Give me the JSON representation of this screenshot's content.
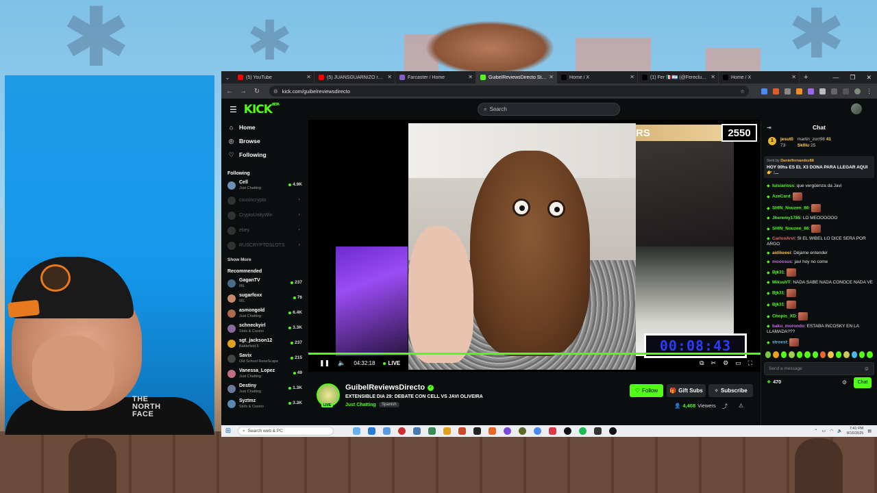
{
  "browser": {
    "tabs": [
      {
        "title": "(5) YouTube",
        "color": "#ff0000",
        "active": false
      },
      {
        "title": "(5) JUANSGUARNIZO reaccion...",
        "color": "#ff0000",
        "active": false
      },
      {
        "title": "Farcaster / Home",
        "color": "#855dcd",
        "active": false
      },
      {
        "title": "GuibelReviewsDirecto Strea...",
        "color": "#53fc18",
        "active": true
      },
      {
        "title": "Home / X",
        "color": "#000000",
        "active": false
      },
      {
        "title": "(1) Fer 🇲🇽🇦🇷 (@Fereclum) / X",
        "color": "#000000",
        "active": false
      },
      {
        "title": "Home / X",
        "color": "#000000",
        "active": false
      }
    ],
    "url": "kick.com/guibelreviewsdirecto"
  },
  "kick": {
    "logo": "KICK",
    "beta": "BETA",
    "search_placeholder": "Search",
    "nav": [
      {
        "label": "Home",
        "icon": "home-icon"
      },
      {
        "label": "Browse",
        "icon": "compass-icon"
      },
      {
        "label": "Following",
        "icon": "heart-icon"
      }
    ],
    "following_header": "Following",
    "following": [
      {
        "name": "Cell",
        "category": "Just Chatting",
        "viewers": "4.9K",
        "live": true,
        "color": "#6e8fb5"
      },
      {
        "name": "cousincrypto",
        "category": "",
        "viewers": "",
        "live": false,
        "color": "#777"
      },
      {
        "name": "CryptoUnityWin",
        "category": "",
        "viewers": "",
        "live": false,
        "color": "#777"
      },
      {
        "name": "ebey",
        "category": "",
        "viewers": "",
        "live": false,
        "color": "#777"
      },
      {
        "name": "RUSCRYPTOSLOTS",
        "category": "",
        "viewers": "",
        "live": false,
        "color": "#777"
      }
    ],
    "show_more": "Show More",
    "recommended_header": "Recommended",
    "recommended": [
      {
        "name": "GaganTV",
        "category": "IRL",
        "viewers": "237",
        "color": "#4a6b8a"
      },
      {
        "name": "sugarfoxx",
        "category": "IRL",
        "viewers": "76",
        "color": "#c48a6a"
      },
      {
        "name": "asmongold",
        "category": "Just Chatting",
        "viewers": "6.4K",
        "color": "#b06a4a"
      },
      {
        "name": "schneckyirl",
        "category": "Slots & Casino",
        "viewers": "3.3K",
        "color": "#8a6a9a"
      },
      {
        "name": "sgt_jackson12",
        "category": "Battlefield 6",
        "viewers": "237",
        "color": "#e0a020"
      },
      {
        "name": "Savix",
        "category": "Old School RuneScape",
        "viewers": "215",
        "color": "#444"
      },
      {
        "name": "Vanessa_Lopez",
        "category": "Just Chatting",
        "viewers": "49",
        "color": "#c07080"
      },
      {
        "name": "Destiny",
        "category": "Just Chatting",
        "viewers": "1.3K",
        "color": "#6a7a9a"
      },
      {
        "name": "Syztmz",
        "category": "Slots & Casino",
        "viewers": "3.3K",
        "color": "#5a8ab0"
      }
    ],
    "player": {
      "score_letters": "RS",
      "score": "2550",
      "timer": "00:08:43",
      "elapsed": "04:32:18",
      "live_label": "LIVE"
    },
    "stream": {
      "streamer": "GuibelReviewsDirecto",
      "live_tag": "LIVE",
      "title": "EXTENSIBLE DIA 29: DEBATE CON CELL VS JAVI OLIVEIRA",
      "category": "Just Chatting",
      "language": "Spanish",
      "follow_label": "Follow",
      "gift_label": "Gift Subs",
      "subscribe_label": "Subscribe",
      "viewers_count": "4,408",
      "viewers_label": "Viewers"
    },
    "chat": {
      "title": "Chat",
      "gifters": {
        "rank": "1",
        "g1_name": "jesut0",
        "g1_count": "73",
        "g2_name": "martin_zorr98",
        "g2_count": "41",
        "g3_name": "Sk0lu",
        "g3_count": "25"
      },
      "pinned_by_prefix": "Sent by",
      "pinned_by_user": "Danielfernandez88",
      "pinned_text": "HOY 00hs ES EL X3 DONA PARA LLEGAR AQUI 👉 :...",
      "messages": [
        {
          "user": "luisiarioss",
          "color": "#53fc18",
          "text": ": que vergüenza da Javi",
          "emote": false
        },
        {
          "user": "AzeCard",
          "color": "#53fc18",
          "text": ":",
          "emote": true
        },
        {
          "user": "SHIN_Nouzen_86",
          "color": "#53fc18",
          "text": ":",
          "emote": true
        },
        {
          "user": "Jheremy1785",
          "color": "#53fc18",
          "text": ": LO MEOOOOOO",
          "emote": false
        },
        {
          "user": "SHIN_Nouzen_86",
          "color": "#53fc18",
          "text": ":",
          "emote": true
        },
        {
          "user": "CarlosArvi",
          "color": "#e86a6a",
          "text": ": SI EL WIBEL LO DICE SERA POR ARGO",
          "emote": false
        },
        {
          "user": "aidikeeei",
          "color": "#f2c14a",
          "text": ": Déjame entender",
          "emote": false
        },
        {
          "user": "mooosus",
          "color": "#c86ae8",
          "text": ": javi hoy no come",
          "emote": false
        },
        {
          "user": "Bjk31",
          "color": "#53fc18",
          "text": ":",
          "emote": true
        },
        {
          "user": "MiksuVT",
          "color": "#53fc18",
          "text": ": NADA SABE NADA CONOCE NADA VE",
          "emote": false
        },
        {
          "user": "Bjk31",
          "color": "#53fc18",
          "text": ":",
          "emote": true
        },
        {
          "user": "Bjk31",
          "color": "#53fc18",
          "text": ":",
          "emote": true
        },
        {
          "user": "Chopis_XD",
          "color": "#53fc18",
          "text": ":",
          "emote": true
        },
        {
          "user": "baku_morondo",
          "color": "#c86ae8",
          "text": ": ESTABA INCOSKY EN LA LLAMADA???",
          "emote": false
        },
        {
          "user": "stroxst",
          "color": "#6ab8e8",
          "text": ":",
          "emote": true
        }
      ],
      "input_placeholder": "Send a message",
      "points": "470",
      "chat_button": "Chat"
    }
  },
  "taskbar": {
    "search_placeholder": "Search web & PC",
    "time": "7:41 PM",
    "date": "8/16/2025"
  },
  "webcam": {
    "brand_line1": "THE",
    "brand_line2": "NORTH",
    "brand_line3": "FACE"
  }
}
